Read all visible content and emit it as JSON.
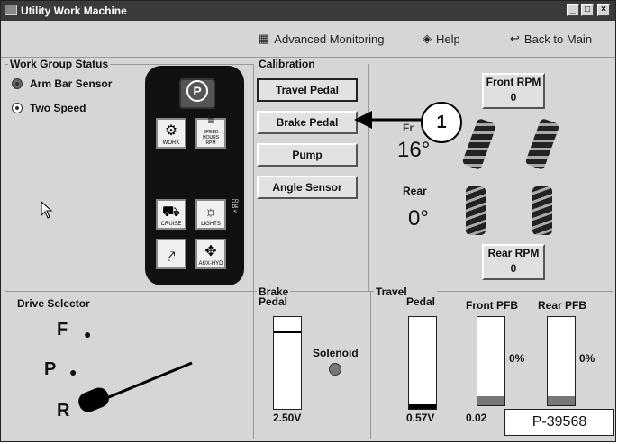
{
  "window": {
    "title": "Utility Work Machine",
    "min_label": "_",
    "max_label": "□",
    "close_label": "×"
  },
  "nav": {
    "advanced_monitoring": "Advanced Monitoring",
    "help": "Help",
    "back_to_main": "Back to Main"
  },
  "work_group": {
    "title": "Work Group Status",
    "items": [
      {
        "label": "Arm Bar Sensor",
        "selected": true
      },
      {
        "label": "Two Speed",
        "selected": false
      }
    ]
  },
  "keypad": {
    "parking_label": "P",
    "keys": [
      {
        "icon": "work-icon",
        "label": "WORK"
      },
      {
        "icon": "speed-hours-rpm-icon",
        "label": "SPEED HOURS RPM"
      },
      {
        "icon": "cruise-icon",
        "label": "CRUISE"
      },
      {
        "icon": "lights-icon",
        "label": "LIGHTS"
      },
      {
        "icon": "tilt-icon",
        "label": ""
      },
      {
        "icon": "aux-hyd-icon",
        "label": "AUX-HYD"
      }
    ],
    "side_label": "CODES"
  },
  "calibration": {
    "title": "Calibration",
    "buttons": [
      "Travel Pedal",
      "Brake Pedal",
      "Pump",
      "Angle Sensor"
    ]
  },
  "angles": {
    "front_value": "16°",
    "front_label": "Fr",
    "rear_label": "Rear",
    "rear_value": "0°"
  },
  "front_rpm": {
    "label": "Front RPM",
    "value": "0"
  },
  "rear_rpm": {
    "label": "Rear RPM",
    "value": "0"
  },
  "drive_selector": {
    "title": "Drive Selector",
    "positions": [
      "F",
      "P",
      "R"
    ]
  },
  "brake": {
    "title": "Brake",
    "pedal_label": "Pedal",
    "solenoid_label": "Solenoid",
    "voltage": "2.50V",
    "level": 0.15
  },
  "travel": {
    "title": "Travel",
    "pedal_label": "Pedal",
    "pedal_voltage": "0.57V",
    "pedal_level": 0.05,
    "front_pfb_label": "Front PFB",
    "front_pfb_value": "0%",
    "front_pfb_reading": "0.02",
    "rear_pfb_label": "Rear PFB",
    "rear_pfb_value": "0%"
  },
  "callout": "1",
  "figure_id": "P-39568",
  "colors": {
    "titlebar": "#3a3a3a",
    "window": "#d6d6d6",
    "keypad": "#111111"
  }
}
